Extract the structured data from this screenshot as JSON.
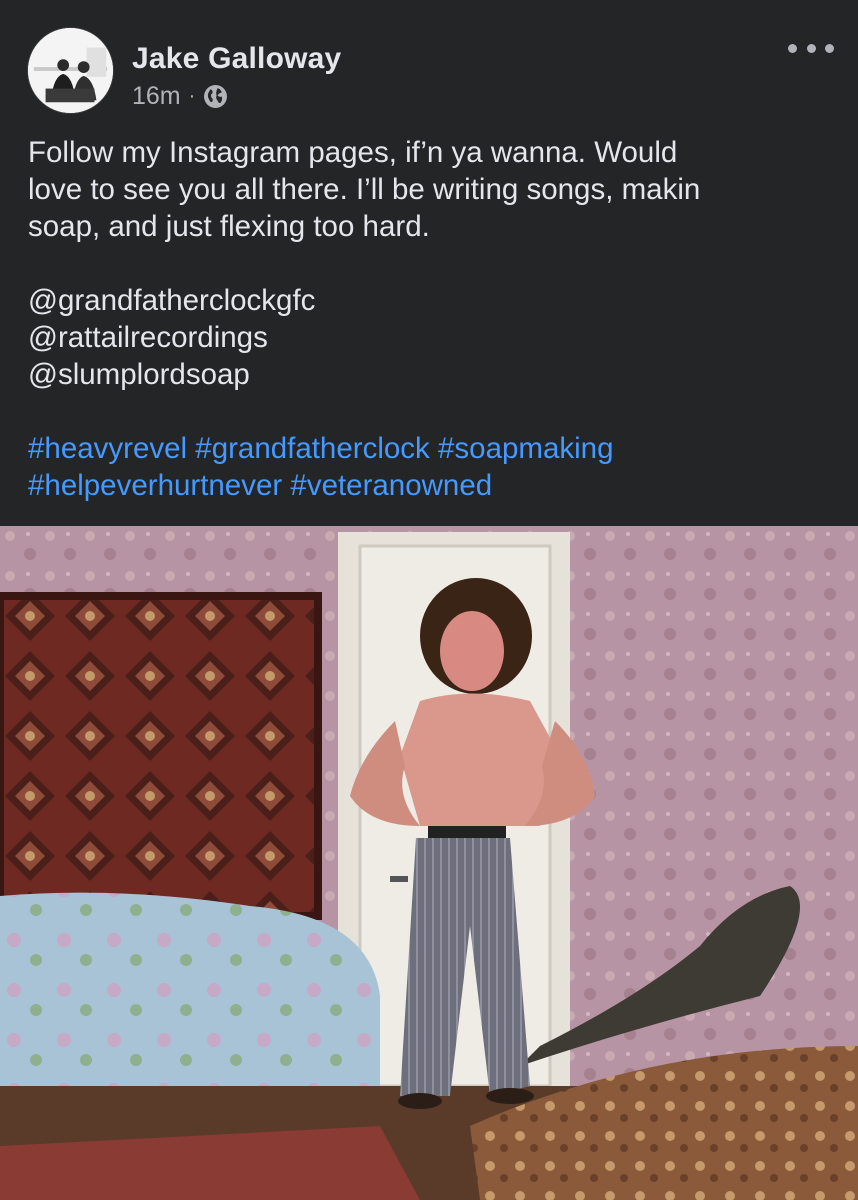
{
  "post": {
    "author": "Jake Galloway",
    "time": "16m",
    "separator": "·",
    "privacy_icon": "globe-icon",
    "more_icon": "more-horizontal-icon",
    "text_lines_p1": [
      "Follow my Instagram pages, if’n ya wanna. Would",
      "love to see you all there. I’ll be writing songs, makin",
      "soap, and just flexing too hard."
    ],
    "mentions": [
      "@grandfatherclockgfc",
      "@rattailrecordings",
      "@slumplordsoap"
    ],
    "hashtags_line1": [
      "#heavyrevel",
      "#grandfatherclock",
      "#soapmaking"
    ],
    "hashtags_line2": [
      "#helpeverhurtnever",
      "#veteranowned"
    ],
    "image_icon": "photo-of-shirtless-man-flexing-in-room"
  },
  "colors": {
    "background": "#242526",
    "text": "#e4e6eb",
    "secondary_text": "#b0b3b8",
    "hashtag": "#4599ff"
  }
}
